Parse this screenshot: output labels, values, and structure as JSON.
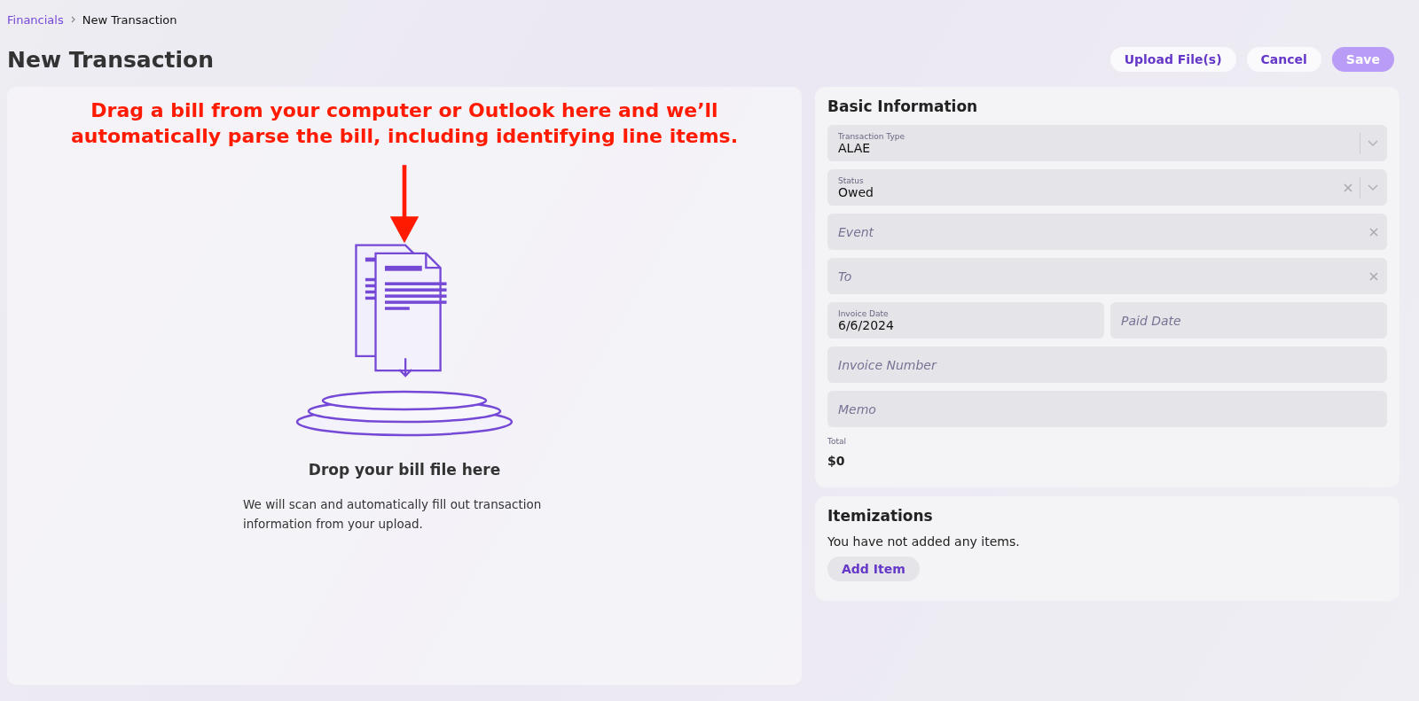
{
  "breadcrumb": {
    "items": [
      "Financials",
      "New Transaction"
    ]
  },
  "title": "New Transaction",
  "actions": [
    {
      "label": "Upload File(s)",
      "disabled": false
    },
    {
      "label": "Cancel",
      "disabled": false
    },
    {
      "label": "Save",
      "disabled": true
    }
  ],
  "dropzone": {
    "annotation": "Drag a bill from your computer or Outlook here and we’ll automatically parse the bill, including identifying line items.",
    "heading": "Drop your bill file here",
    "description": "We will scan and automatically fill out transaction information from your upload."
  },
  "basic_information": {
    "title": "Basic Information",
    "fields": [
      {
        "kind": "select",
        "label": "Transaction Type",
        "value": "ALAE",
        "clearable": false
      },
      {
        "kind": "select",
        "label": "Status",
        "value": "Owed",
        "clearable": true
      },
      {
        "kind": "text",
        "placeholder": "Event",
        "clearable": true
      },
      {
        "kind": "text",
        "placeholder": "To",
        "clearable": true
      },
      {
        "kind": "pair",
        "items": [
          {
            "label": "Invoice Date",
            "value": "6/6/2024"
          },
          {
            "placeholder": "Paid Date"
          }
        ]
      },
      {
        "kind": "text",
        "placeholder": "Invoice Number",
        "clearable": false
      },
      {
        "kind": "text",
        "placeholder": "Memo",
        "clearable": false
      }
    ],
    "total_label": "Total",
    "total_value": "$0"
  },
  "itemizations": {
    "title": "Itemizations",
    "empty_text": "You have not added any items.",
    "button": "Add Item"
  }
}
